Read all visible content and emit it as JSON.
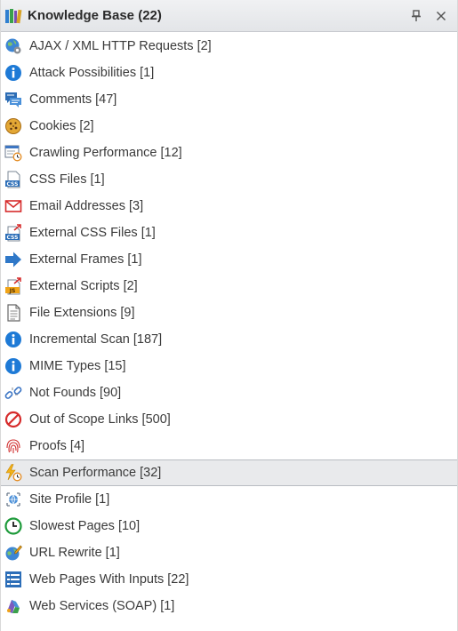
{
  "panel": {
    "title": "Knowledge Base (22)",
    "pin_icon": "pin-icon",
    "close_icon": "close-icon",
    "title_icon": "books-icon"
  },
  "items": [
    {
      "label": "AJAX / XML HTTP Requests [2]",
      "icon": "globe-gear-icon"
    },
    {
      "label": "Attack Possibilities [1]",
      "icon": "info-icon"
    },
    {
      "label": "Comments [47]",
      "icon": "comments-icon"
    },
    {
      "label": "Cookies [2]",
      "icon": "cookie-icon"
    },
    {
      "label": "Crawling Performance [12]",
      "icon": "calendar-clock-icon"
    },
    {
      "label": "CSS Files [1]",
      "icon": "css-file-icon"
    },
    {
      "label": "Email Addresses [3]",
      "icon": "envelope-icon"
    },
    {
      "label": "External CSS Files [1]",
      "icon": "external-css-icon"
    },
    {
      "label": "External Frames [1]",
      "icon": "arrow-right-icon"
    },
    {
      "label": "External Scripts [2]",
      "icon": "external-js-icon"
    },
    {
      "label": "File Extensions [9]",
      "icon": "document-icon"
    },
    {
      "label": "Incremental Scan [187]",
      "icon": "info-icon"
    },
    {
      "label": "MIME Types [15]",
      "icon": "info-icon"
    },
    {
      "label": "Not Founds [90]",
      "icon": "broken-link-icon"
    },
    {
      "label": "Out of Scope Links [500]",
      "icon": "prohibited-icon"
    },
    {
      "label": "Proofs [4]",
      "icon": "fingerprint-icon"
    },
    {
      "label": "Scan Performance [32]",
      "icon": "lightning-clock-icon",
      "selected": true
    },
    {
      "label": "Site Profile [1]",
      "icon": "site-profile-icon"
    },
    {
      "label": "Slowest Pages [10]",
      "icon": "green-clock-icon"
    },
    {
      "label": "URL Rewrite [1]",
      "icon": "globe-pencil-icon"
    },
    {
      "label": "Web Pages With Inputs [22]",
      "icon": "form-list-icon"
    },
    {
      "label": "Web Services (SOAP) [1]",
      "icon": "web-services-icon"
    }
  ],
  "colors": {
    "accent_blue": "#1e7ad6",
    "selected_bg": "#e9eaec"
  }
}
